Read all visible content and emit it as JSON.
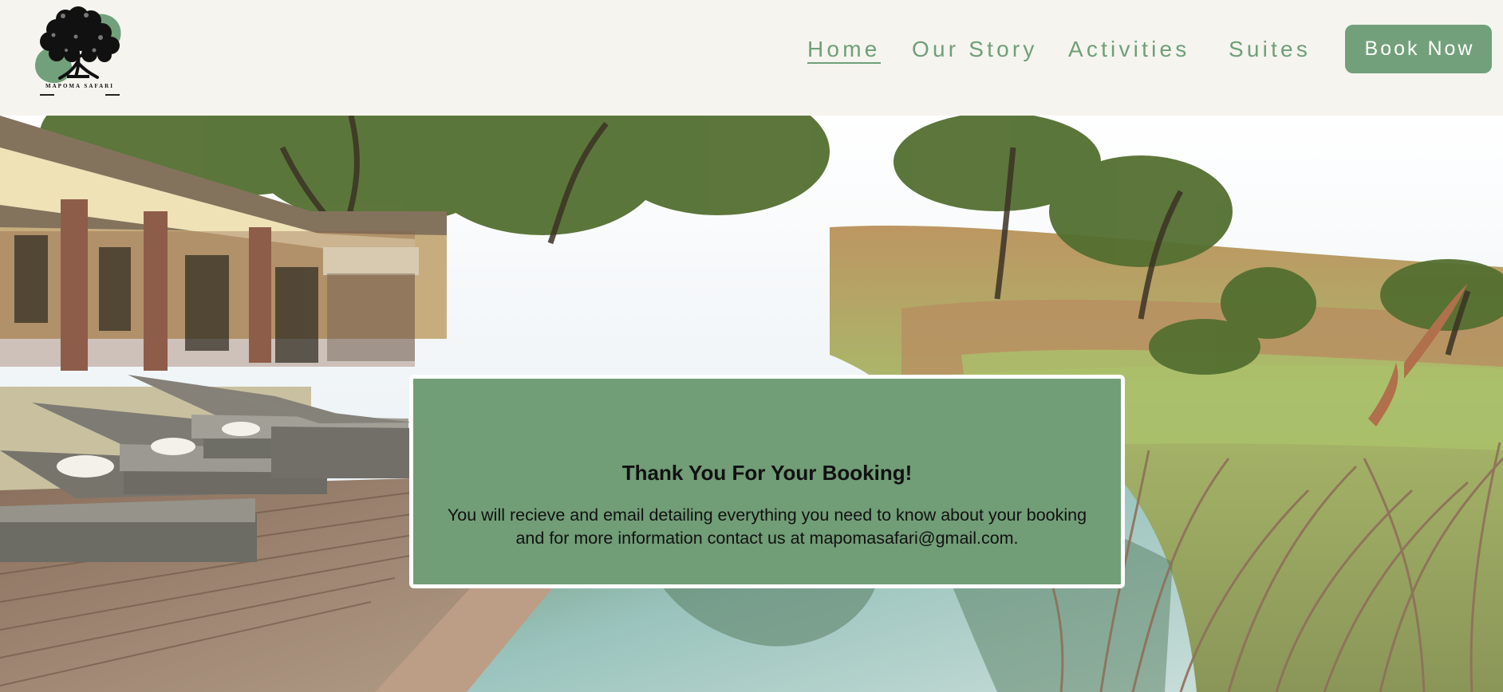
{
  "brand": {
    "logo_text": "MAPOMA SAFARI",
    "colors": {
      "green": "#719d77",
      "header_background": "#f5f4ef"
    }
  },
  "navigation": {
    "items": [
      {
        "label": "Home",
        "state": "active"
      },
      {
        "label": "Our Story"
      },
      {
        "label": "Activities"
      },
      {
        "label": "Suites"
      }
    ],
    "book_button": "Book Now"
  },
  "message": {
    "title": "Thank You For Your Booking!",
    "body": "You will recieve and email detailing everything you need to know about your booking and for more information contact us at mapomasafari@gmail.com."
  },
  "hero": {
    "scene": "safari lodge pool and savanna"
  },
  "icons": {
    "logo": "tree-icon"
  }
}
